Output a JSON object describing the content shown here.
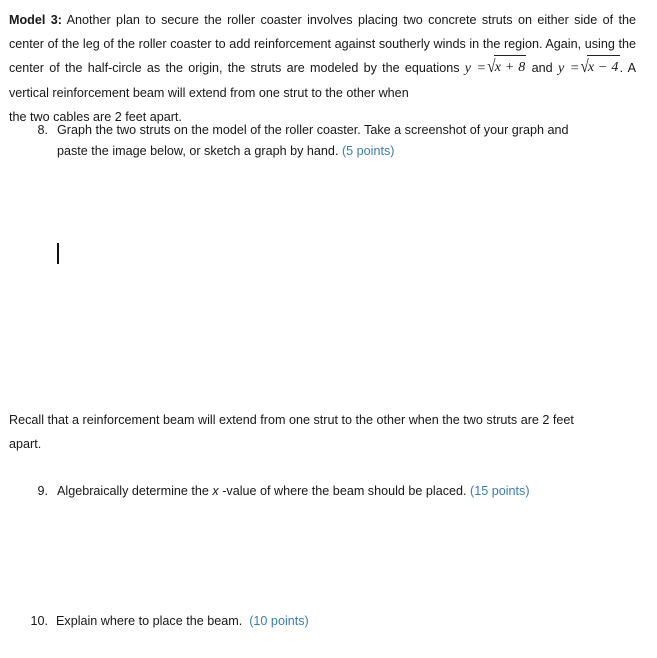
{
  "document": {
    "model_label": "Model 3:",
    "intro_part1": " Another plan to secure the roller coaster involves placing two concrete struts on either side of the center of the leg of the roller coaster to add reinforcement against southerly winds in the region. Again, using the center of the half-circle as the origin, the struts are modeled by the equations",
    "equation_1": {
      "lhs": "y =",
      "radicand": "x + 8"
    },
    "equation_conjunction": "and",
    "equation_2": {
      "lhs": "y =",
      "radicand": "x − 4"
    },
    "intro_part2": ". A vertical reinforcement beam will extend from one strut to the other when",
    "intro_part3": "the two cables are 2 feet apart.",
    "recall_text": "Recall that a reinforcement beam will extend from one strut to the other when the two struts are 2 feet",
    "recall_text_last": "apart."
  },
  "questions": [
    {
      "number": "8.",
      "text": "Graph the two struts on the model of the roller coaster. Take a screenshot of your graph and paste the image below, or sketch a graph by hand.",
      "points": "(5 points)"
    },
    {
      "number": "9.",
      "text_before_var": "Algebraically determine the ",
      "variable": "x",
      "text_after_var": " -value of where the beam should be placed.",
      "points": "(15 points)"
    },
    {
      "number": "10.",
      "text": "Explain where to place the beam.",
      "points": "(10 points)"
    }
  ],
  "editor": {
    "caret_present": true
  },
  "colors": {
    "points_blue": "#3c7fa6",
    "body_text": "#181818",
    "background": "#ffffff"
  }
}
